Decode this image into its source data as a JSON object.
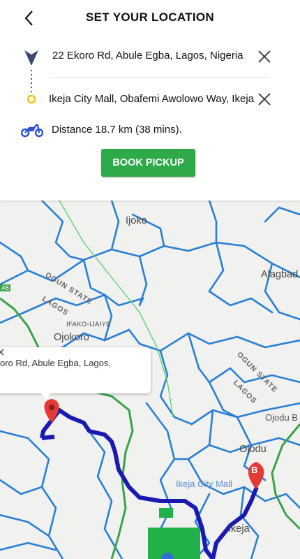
{
  "header": {
    "title": "SET YOUR LOCATION",
    "back_icon": "chevron-left-icon"
  },
  "origin": {
    "address": "22 Ekoro Rd, Abule Egba, Lagos, Nigeria",
    "icon": "origin-chevron-icon"
  },
  "destination": {
    "address": "Ikeja City Mall, Obafemi Awolowo Way, Ikeja",
    "icon": "destination-circle-icon"
  },
  "distance": {
    "text": "Distance 18.7 km (38 mins).",
    "icon": "motorbike-icon"
  },
  "book_button": {
    "label": "BOOK PICKUP"
  },
  "colors": {
    "accent_green": "#2faa4a",
    "route_blue": "#1a1ab0",
    "marker_red": "#e53935",
    "destination_yellow": "#f4c20d",
    "origin_navy": "#3b4a7a"
  },
  "map": {
    "labels": {
      "ijoko": "Ijoko",
      "alagbado": "Alagbad",
      "ogun_state_1": "OGUN STATE",
      "lagos_1": "LAGOS",
      "ifako_ijaiye": "IFAKO-IJAIYE",
      "ojokoro": "Ojokoro",
      "ogun_state_2": "OGUN STATE",
      "lagos_2": "LAGOS",
      "ojodu_b": "Ojodu B",
      "ojodu": "Ojodu",
      "ikeja_city_mall": "Ikeja City Mall",
      "ikeja": "Ikeja",
      "a5": "A5"
    },
    "popup": {
      "text": "oro Rd, Abule Egba, Lagos,"
    },
    "marker_b": {
      "label": "B"
    }
  }
}
